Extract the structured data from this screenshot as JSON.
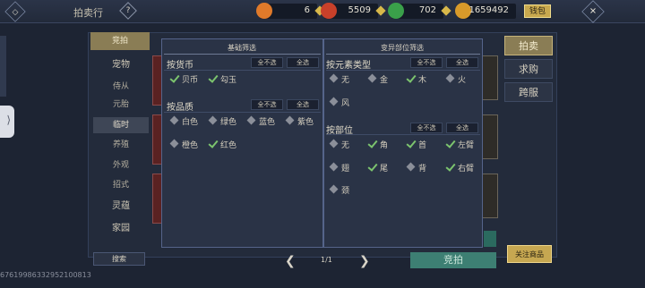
{
  "header": {
    "title": "拍卖行",
    "help_label": "?",
    "back_label": "◇",
    "close_label": "✕",
    "resources": [
      {
        "name": "ticket",
        "value": "6",
        "color": "#e07a2a"
      },
      {
        "name": "shell",
        "value": "5509",
        "color": "#c8402a"
      },
      {
        "name": "jade",
        "value": "702",
        "color": "#3aa04a"
      },
      {
        "name": "coin",
        "value": "1659492",
        "color": "#d89a2a"
      }
    ],
    "wallet_label": "钱包"
  },
  "left_panel": {
    "tab_label": "竞拍",
    "categories": [
      {
        "label": "宠物",
        "big": true
      },
      {
        "label": "侍从"
      },
      {
        "label": "元胎"
      },
      {
        "label": "临时",
        "active": true
      },
      {
        "label": "养殖"
      },
      {
        "label": "外观"
      },
      {
        "label": "招式"
      },
      {
        "label": "灵蕴",
        "big": true
      },
      {
        "label": "家园",
        "big": true
      }
    ],
    "search_label": "搜索"
  },
  "right_panel": {
    "tabs": [
      {
        "label": "拍卖",
        "active": true
      },
      {
        "label": "求购"
      },
      {
        "label": "跨服"
      }
    ],
    "watch_label": "关注商品"
  },
  "pagination": {
    "prev": "❮",
    "next": "❯",
    "text": "1/1"
  },
  "bid_label": "竞拍",
  "user_id": "676199863329521008​13",
  "filter": {
    "basic_title": "基础筛选",
    "mutant_title": "变异部位筛选",
    "deselect_all": "全不选",
    "select_all": "全选",
    "currency": {
      "title": "按货币",
      "options": [
        {
          "label": "贝币",
          "checked": true
        },
        {
          "label": "勾玉",
          "checked": true
        }
      ]
    },
    "quality": {
      "title": "按品质",
      "options": [
        {
          "label": "白色",
          "checked": false
        },
        {
          "label": "绿色",
          "checked": false
        },
        {
          "label": "蓝色",
          "checked": false
        },
        {
          "label": "紫色",
          "checked": false
        },
        {
          "label": "橙色",
          "checked": false
        },
        {
          "label": "红色",
          "checked": true
        }
      ]
    },
    "element": {
      "title": "按元素类型",
      "options": [
        {
          "label": "无",
          "checked": false
        },
        {
          "label": "金",
          "checked": false
        },
        {
          "label": "木",
          "checked": true
        },
        {
          "label": "火",
          "checked": false
        },
        {
          "label": "风",
          "checked": false
        }
      ]
    },
    "part": {
      "title": "按部位",
      "options": [
        {
          "label": "无",
          "checked": false
        },
        {
          "label": "角",
          "checked": true
        },
        {
          "label": "首",
          "checked": true
        },
        {
          "label": "左臂",
          "checked": true
        },
        {
          "label": "翅",
          "checked": false
        },
        {
          "label": "尾",
          "checked": true
        },
        {
          "label": "背",
          "checked": false
        },
        {
          "label": "右臂",
          "checked": true
        },
        {
          "label": "颈",
          "checked": false
        }
      ]
    }
  }
}
